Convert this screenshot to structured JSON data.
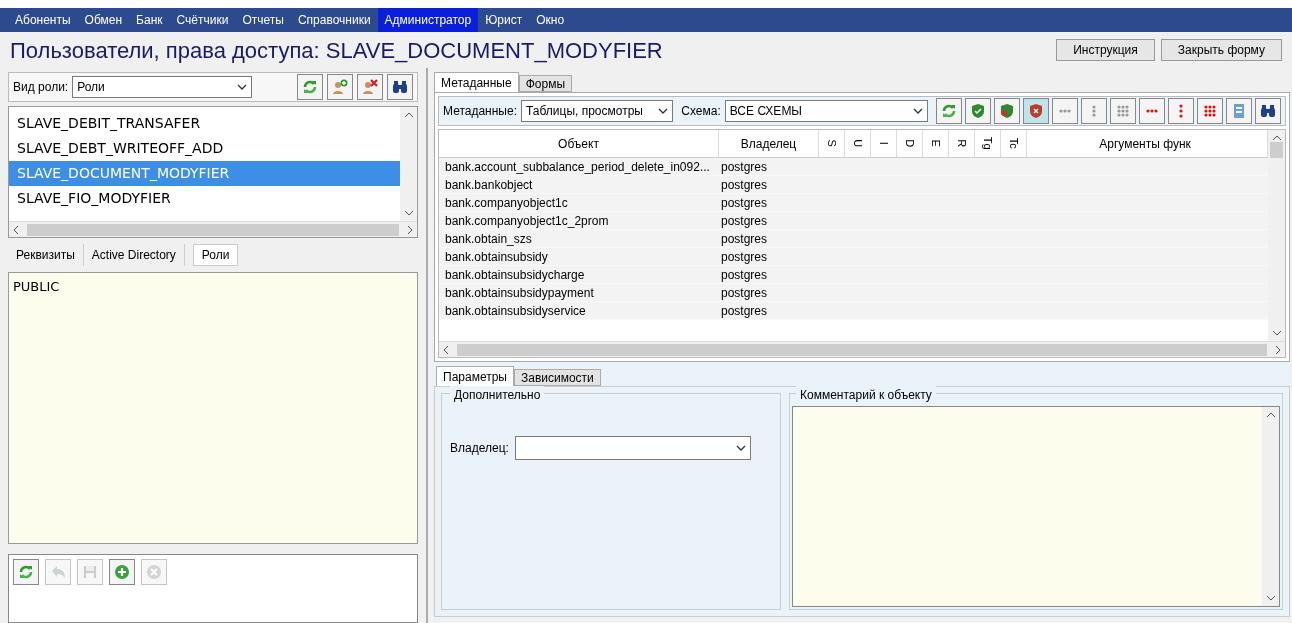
{
  "menu": [
    {
      "label": "Абоненты",
      "selected": false
    },
    {
      "label": "Обмен",
      "selected": false
    },
    {
      "label": "Банк",
      "selected": false
    },
    {
      "label": "Счётчики",
      "selected": false
    },
    {
      "label": "Отчеты",
      "selected": false
    },
    {
      "label": "Справочники",
      "selected": false
    },
    {
      "label": "Администратор",
      "selected": true
    },
    {
      "label": "Юрист",
      "selected": false
    },
    {
      "label": "Окно",
      "selected": false
    }
  ],
  "title": "Пользователи, права доступа: SLAVE_DOCUMENT_MODYFIER",
  "header_buttons": [
    "Инструкция",
    "Закрыть форму"
  ],
  "left": {
    "role_kind": {
      "label": "Вид роли:",
      "value": "Роли"
    },
    "toolbar": [
      {
        "kind": "refresh"
      },
      {
        "kind": "add-user"
      },
      {
        "kind": "remove-user"
      },
      {
        "kind": "find"
      }
    ],
    "roles": [
      {
        "name": "SLAVE_DEBIT_TRANSAFER",
        "selected": false
      },
      {
        "name": "SLAVE_DEBT_WRITEOFF_ADD",
        "selected": false
      },
      {
        "name": "SLAVE_DOCUMENT_MODYFIER",
        "selected": true
      },
      {
        "name": "SLAVE_FIO_MODYFIER",
        "selected": false
      }
    ],
    "tabs": [
      {
        "label": "Реквизиты",
        "selected": false
      },
      {
        "label": "Active Directory",
        "selected": false
      },
      {
        "label": "Роли",
        "selected": true
      }
    ],
    "granted_roles": [
      "PUBLIC"
    ],
    "bottom_toolbar": [
      {
        "kind": "refresh",
        "disabled": false
      },
      {
        "kind": "undo",
        "disabled": true
      },
      {
        "kind": "save",
        "disabled": true
      },
      {
        "kind": "add",
        "disabled": false
      },
      {
        "kind": "cancel",
        "disabled": true
      }
    ]
  },
  "right": {
    "tabs": [
      {
        "label": "Метаданные",
        "selected": true
      },
      {
        "label": "Формы",
        "selected": false
      }
    ],
    "metadata_filter": {
      "label": "Метаданные:",
      "value": "Таблицы, просмотры"
    },
    "schema_filter": {
      "label": "Схема:",
      "value": "ВСЕ СХЕМЫ"
    },
    "toolbar": [
      {
        "kind": "refresh"
      },
      {
        "kind": "shield-green"
      },
      {
        "kind": "shield-user"
      },
      {
        "kind": "shield-red"
      },
      {
        "kind": "dots-row-grey"
      },
      {
        "kind": "dots-col-grey"
      },
      {
        "kind": "dots-grid-grey"
      },
      {
        "kind": "dots-row-red"
      },
      {
        "kind": "dots-col-red"
      },
      {
        "kind": "dots-grid-red"
      },
      {
        "kind": "export"
      },
      {
        "kind": "find"
      }
    ],
    "columns": [
      {
        "label": "Объект",
        "kind": "wide"
      },
      {
        "label": "Владелец",
        "kind": "medium"
      },
      {
        "label": "S",
        "kind": "rotated"
      },
      {
        "label": "U",
        "kind": "rotated"
      },
      {
        "label": "I",
        "kind": "rotated"
      },
      {
        "label": "D",
        "kind": "rotated"
      },
      {
        "label": "E",
        "kind": "rotated"
      },
      {
        "label": "R",
        "kind": "rotated"
      },
      {
        "label": "Tg",
        "kind": "rotated"
      },
      {
        "label": "Tc",
        "kind": "rotated"
      },
      {
        "label": "Аргументы функ",
        "kind": "fill"
      }
    ],
    "rows": [
      [
        "bank.account_subbalance_period_delete_in092...",
        "postgres"
      ],
      [
        "bank.bankobject",
        "postgres"
      ],
      [
        "bank.companyobject1c",
        "postgres"
      ],
      [
        "bank.companyobject1c_2prom",
        "postgres"
      ],
      [
        "bank.obtain_szs",
        "postgres"
      ],
      [
        "bank.obtainsubsidy",
        "postgres"
      ],
      [
        "bank.obtainsubsidycharge",
        "postgres"
      ],
      [
        "bank.obtainsubsidypayment",
        "postgres"
      ],
      [
        "bank.obtainsubsidyservice",
        "postgres"
      ]
    ],
    "detail_tabs": [
      {
        "label": "Параметры",
        "selected": true
      },
      {
        "label": "Зависимости",
        "selected": false
      }
    ],
    "extra_group": {
      "title": "Дополнительно",
      "owner_label": "Владелец:"
    },
    "comment_group": {
      "title": "Комментарий к объекту"
    }
  }
}
